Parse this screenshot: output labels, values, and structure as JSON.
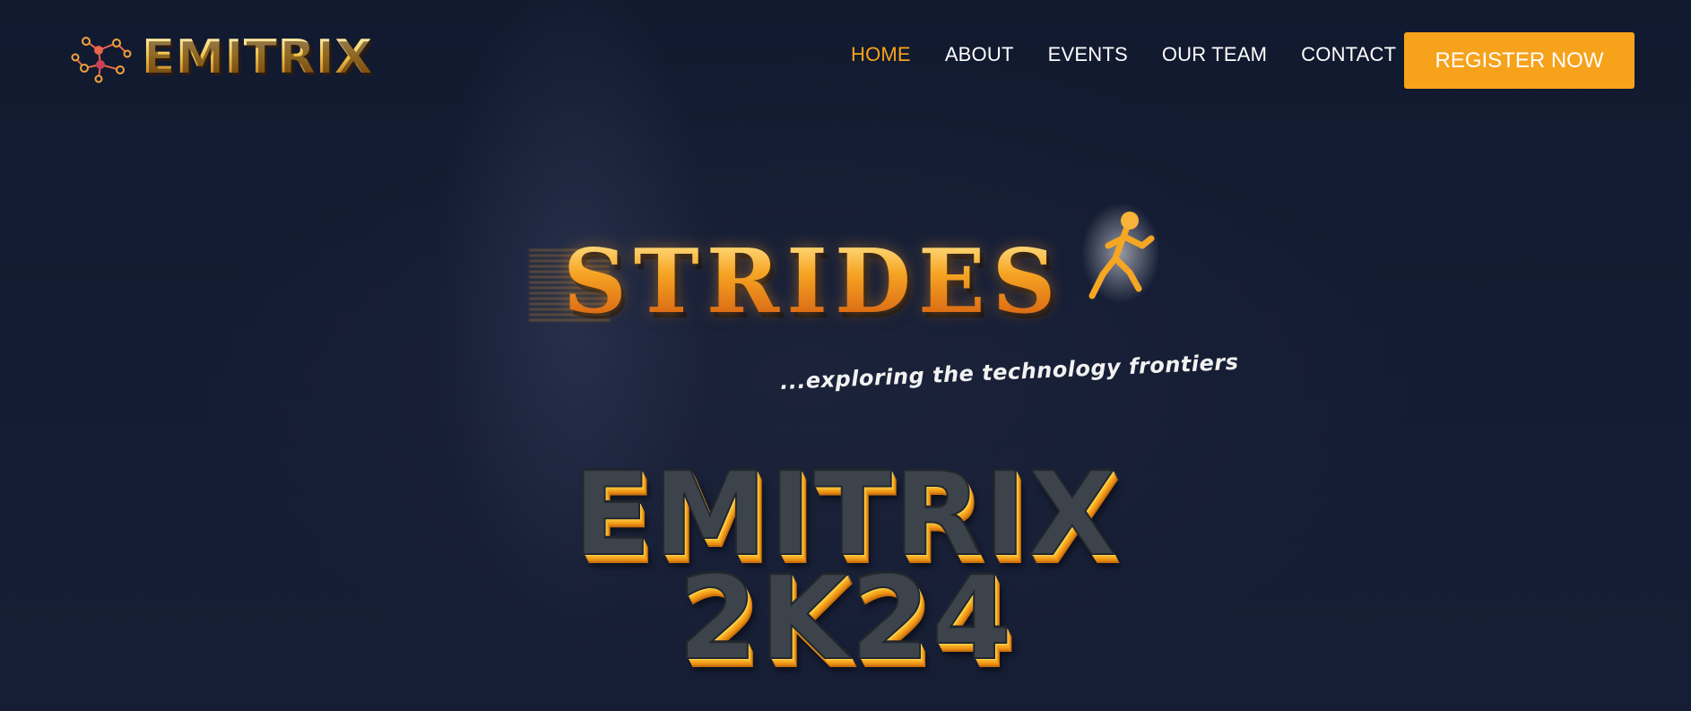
{
  "header": {
    "brand_name": "EMITRIX",
    "nav": [
      {
        "label": "HOME",
        "active": true
      },
      {
        "label": "ABOUT",
        "active": false
      },
      {
        "label": "EVENTS",
        "active": false
      },
      {
        "label": "OUR TEAM",
        "active": false
      },
      {
        "label": "CONTACT",
        "active": false
      }
    ],
    "register_label": "REGISTER NOW"
  },
  "hero": {
    "strides_title": "STRIDES",
    "tagline": "...exploring the technology frontiers",
    "event_title_line1": "EMITRIX",
    "event_title_line2": "2K24"
  },
  "colors": {
    "background": "#131b31",
    "accent": "#f7a21b",
    "nav_text": "#ffffff",
    "title_face": "#3d434b",
    "title_edge": "#f2a01b"
  },
  "icons": {
    "brand_logo": "network-nodes-icon",
    "strides_figure": "running-mannequin-icon"
  }
}
